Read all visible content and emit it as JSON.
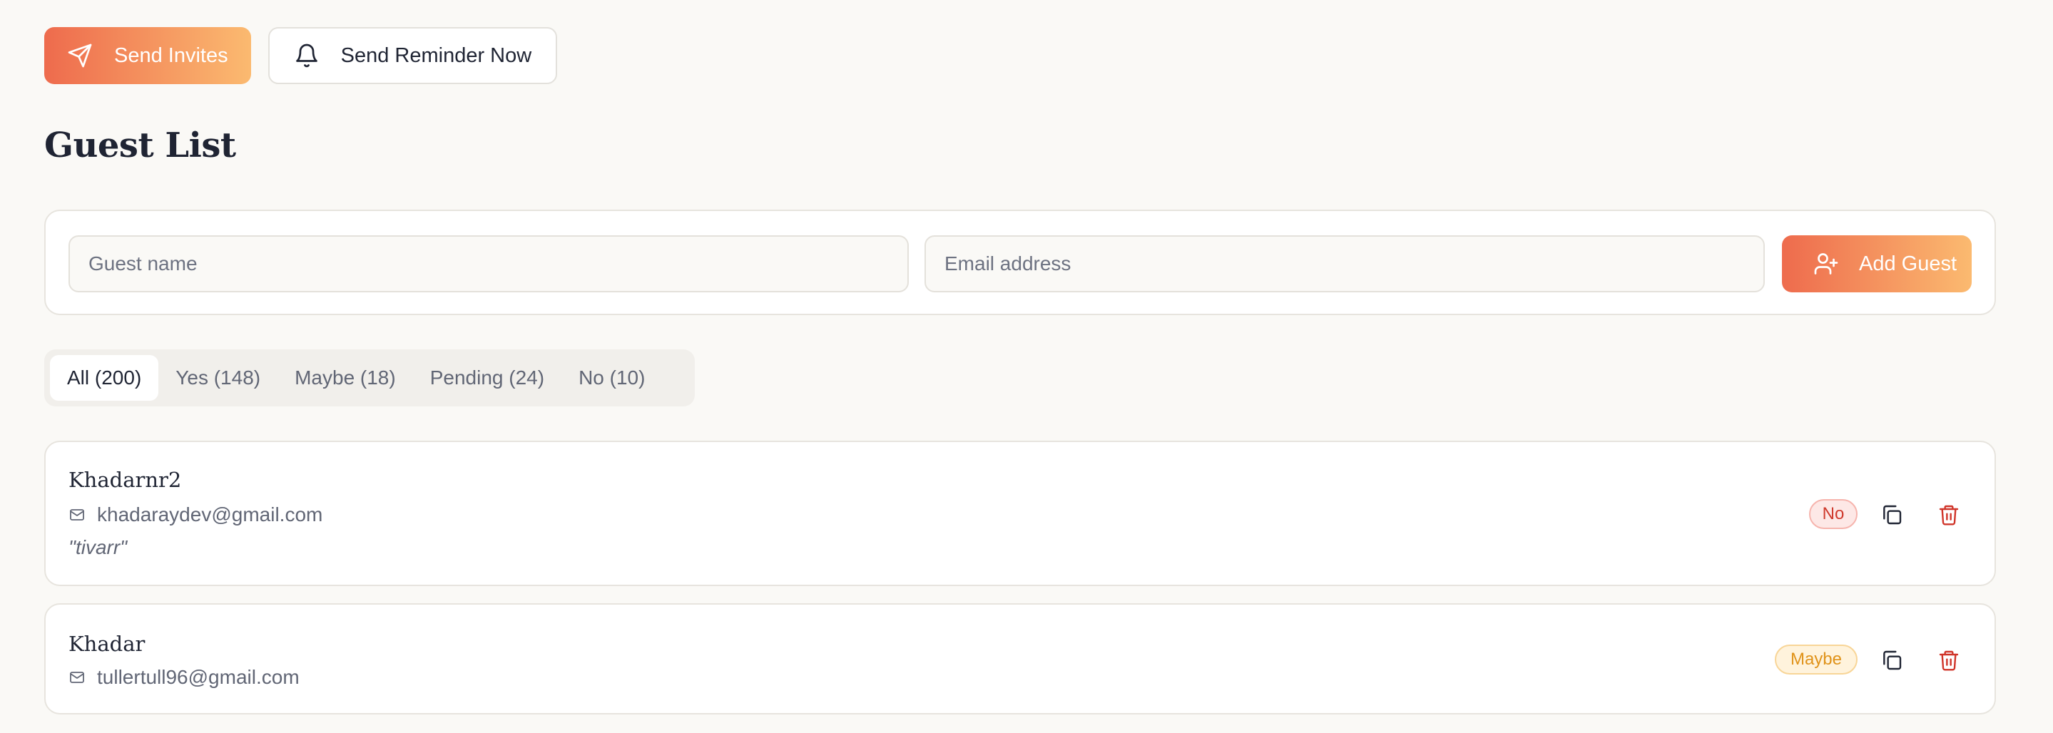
{
  "toolbar": {
    "send_invites_label": "Send Invites",
    "send_reminder_label": "Send Reminder Now"
  },
  "page": {
    "title": "Guest List"
  },
  "add_guest": {
    "name_placeholder": "Guest name",
    "email_placeholder": "Email address",
    "button_label": "Add Guest"
  },
  "filters": [
    {
      "label": "All (200)",
      "active": true
    },
    {
      "label": "Yes (148)",
      "active": false
    },
    {
      "label": "Maybe (18)",
      "active": false
    },
    {
      "label": "Pending (24)",
      "active": false
    },
    {
      "label": "No (10)",
      "active": false
    }
  ],
  "guests": [
    {
      "name": "Khadarnr2",
      "email": "khadaraydev@gmail.com",
      "note": "\"tivarr\"",
      "status": "No"
    },
    {
      "name": "Khadar",
      "email": "tullertull96@gmail.com",
      "status": "Maybe"
    }
  ],
  "colors": {
    "accent_start": "#ee6b4d",
    "accent_end": "#fbba70",
    "background": "#faf9f6",
    "status_no": "#cf3a2d",
    "status_maybe": "#e0931a"
  },
  "icons": {
    "send_invites": "paper-plane-icon",
    "send_reminder": "bell-icon",
    "add_guest": "user-plus-icon",
    "email": "mail-icon",
    "copy": "copy-icon",
    "delete": "trash-icon"
  }
}
